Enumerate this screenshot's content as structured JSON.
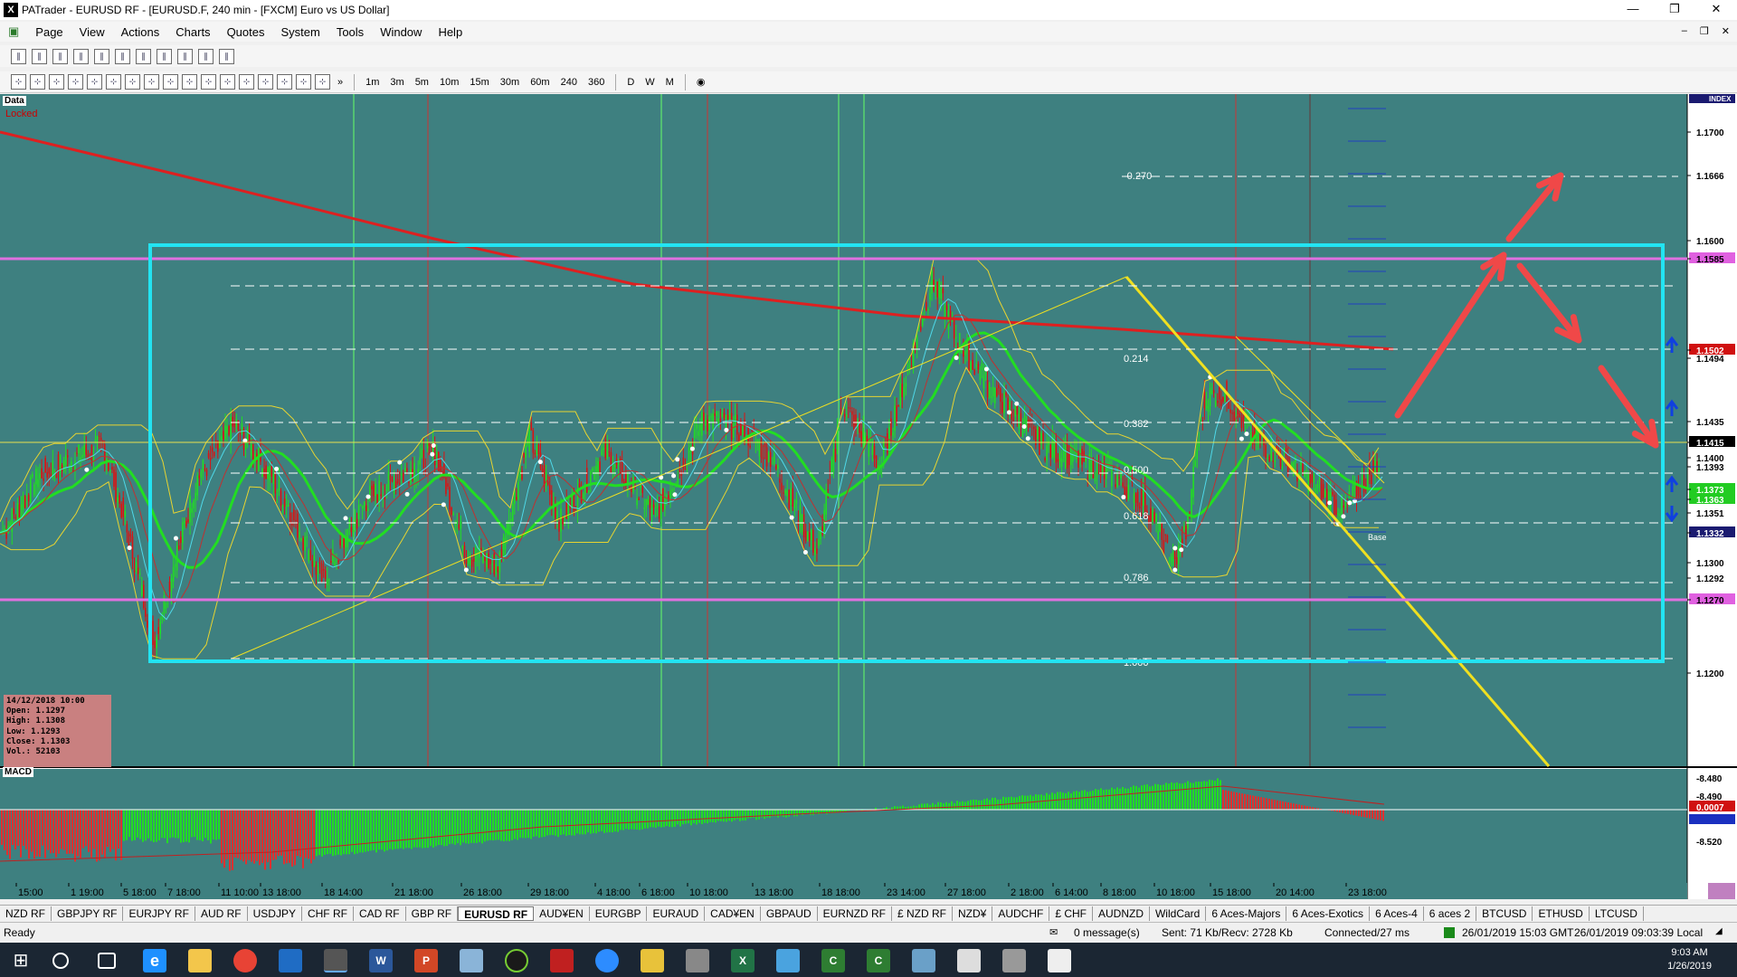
{
  "window": {
    "title": "PATrader - EURUSD RF - [EURUSD.F, 240 min - [FXCM] Euro vs US Dollar]",
    "app_icon": "X"
  },
  "menu": [
    "Page",
    "View",
    "Actions",
    "Charts",
    "Quotes",
    "System",
    "Tools",
    "Window",
    "Help"
  ],
  "timeframes": [
    "1m",
    "3m",
    "5m",
    "10m",
    "15m",
    "30m",
    "60m",
    "240",
    "360",
    "D",
    "W",
    "M"
  ],
  "chart": {
    "data_label": "Data",
    "locked_label": "Locked",
    "index_label": "INDEX",
    "price_axis": [
      "1.1700",
      "1.1666",
      "1.1600",
      "1.1585",
      "1.1502",
      "1.1494",
      "1.1435",
      "1.1415",
      "1.1400",
      "1.1393",
      "1.1373",
      "1.1363",
      "1.1351",
      "1.1332",
      "1.1300",
      "1.1292",
      "1.1270",
      "1.1200"
    ],
    "fib_levels": [
      "-0.270",
      "0.214",
      "0.382",
      "0.500",
      "0.618",
      "0.786",
      "1.000"
    ],
    "time_axis": [
      "15:00",
      "1 19:00",
      "5 18:00",
      "7 18:00",
      "11 10:00",
      "13 18:00",
      "18 14:00",
      "21 18:00",
      "26 18:00",
      "29 18:00",
      "4 18:00",
      "6 18:00",
      "10 18:00",
      "13 18:00",
      "18 18:00",
      "23 14:00",
      "27 18:00",
      "2 18:00",
      "6 14:00",
      "8 18:00",
      "10 18:00",
      "15 18:00",
      "20 14:00",
      "23 18:00"
    ],
    "macd_axis": [
      "-8.480",
      "-8.490",
      "0.0007",
      "-8.510",
      "-8.520"
    ],
    "macd_label": "MACD",
    "base_label": "Base",
    "info": {
      "date": "14/12/2018 10:00",
      "open": "Open: 1.1297",
      "high": "High: 1.1308",
      "low": "Low: 1.1293",
      "close": "Close: 1.1303",
      "vol": "Vol.: 52103"
    },
    "colors": {
      "background": "#3e8080",
      "candle_up": "#22dd22",
      "candle_down": "#dd1111",
      "box": "#22e4f2",
      "band": "#e070e0",
      "trend": "#f0e020",
      "ma_red": "#dd2020",
      "ma_green": "#22dd22"
    }
  },
  "tabs": [
    "NZD RF",
    "GBPJPY RF",
    "EURJPY RF",
    "AUD RF",
    "USDJPY",
    "CHF RF",
    "CAD RF",
    "GBP RF",
    "EURUSD RF",
    "AUD¥EN",
    "EURGBP",
    "EURAUD",
    "CAD¥EN",
    "GBPAUD",
    "EURNZD RF",
    "£ NZD RF",
    "NZD¥",
    "AUDCHF",
    "£ CHF",
    "AUDNZD",
    "WildCard",
    "6 Aces-Majors",
    "6 Aces-Exotics",
    "6 Aces-4",
    "6 aces 2",
    "BTCUSD",
    "ETHUSD",
    "LTCUSD"
  ],
  "active_tab": "EURUSD RF",
  "status": {
    "ready": "Ready",
    "messages": "0 message(s)",
    "sent": "Sent: 71 Kb/Recv: 2728 Kb",
    "connected": "Connected/27 ms",
    "time_gmt": "26/01/2019 15:03 GMT",
    "time_local": "26/01/2019 09:03:39 Local"
  },
  "taskbar": {
    "time": "9:03 AM",
    "date": "1/26/2019"
  }
}
